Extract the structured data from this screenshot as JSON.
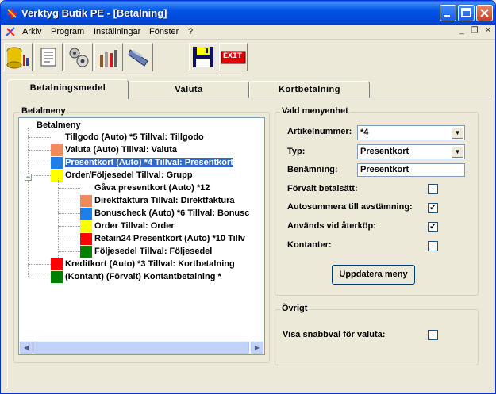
{
  "window": {
    "title": "Verktyg Butik PE - [Betalning]"
  },
  "menu": {
    "items": [
      "Arkiv",
      "Program",
      "Inställningar",
      "Fönster",
      "?"
    ]
  },
  "toolbar": {
    "tools": [
      "database-icon",
      "document-icon",
      "settings-icon",
      "tools-icon",
      "reader-icon"
    ],
    "save_icon": "floppy-disk-icon",
    "exit_label": "EXIT"
  },
  "tabs": [
    {
      "label": "Betalningsmedel",
      "active": true
    },
    {
      "label": "Valuta",
      "active": false
    },
    {
      "label": "Kortbetalning",
      "active": false
    }
  ],
  "betalmeny": {
    "group_title": "Betalmeny",
    "root": "Betalmeny",
    "nodes": [
      {
        "label": "Tillgodo (Auto) *5 Tillval: Tillgodo",
        "color": null
      },
      {
        "label": "Valuta (Auto) Tillval: Valuta",
        "color": "#f08a5d"
      },
      {
        "label": "Presentkort (Auto) *4 Tillval: Presentkort",
        "color": "#1e7fe8",
        "selected": true
      },
      {
        "label": "Order/Följesedel Tillval: Grupp",
        "color": "#ffff00"
      },
      {
        "label": "Gåva presentkort (Auto) *12",
        "color": null
      },
      {
        "label": "Direktfaktura Tillval: Direktfaktura",
        "color": "#f08a5d"
      },
      {
        "label": "Bonuscheck (Auto) *6 Tillval: Bonusc",
        "color": "#1e7fe8"
      },
      {
        "label": "Order Tillval: Order",
        "color": "#ffff00"
      },
      {
        "label": "Retain24 Presentkort (Auto) *10 Tillv",
        "color": "#ff0000"
      },
      {
        "label": "Följesedel Tillval: Följesedel",
        "color": "#008000"
      },
      {
        "label": "Kreditkort (Auto) *3 Tillval: Kortbetalning",
        "color": "#ff0000"
      },
      {
        "label": "(Kontant) (Förvalt) Kontantbetalning *",
        "color": "#008000"
      }
    ]
  },
  "vald": {
    "group_title": "Vald menyenhet",
    "artikelnummer_label": "Artikelnummer:",
    "artikelnummer_value": "*4",
    "typ_label": "Typ:",
    "typ_value": "Presentkort",
    "benamning_label": "Benämning:",
    "benamning_value": "Presentkort",
    "forvalt_label": "Förvalt betalsätt:",
    "forvalt_checked": false,
    "autosummera_label": "Autosummera till avstämning:",
    "autosummera_checked": true,
    "aterkop_label": "Används vid återköp:",
    "aterkop_checked": true,
    "kontanter_label": "Kontanter:",
    "kontanter_checked": false,
    "update_button": "Uppdatera meny"
  },
  "ovrigt": {
    "group_title": "Övrigt",
    "snabbval_label": "Visa snabbval för valuta:",
    "snabbval_checked": false
  }
}
